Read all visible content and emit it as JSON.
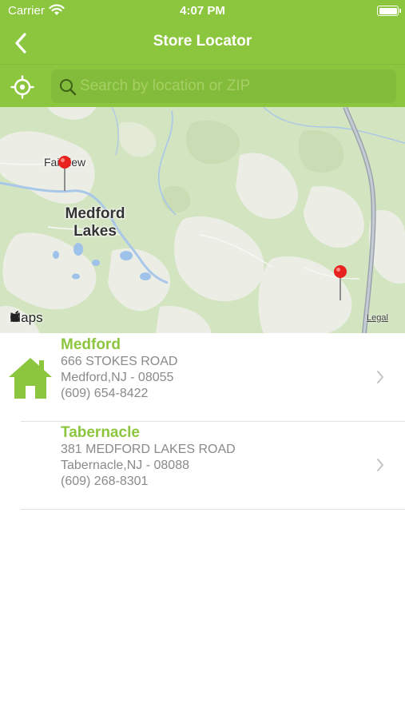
{
  "status_bar": {
    "carrier": "Carrier",
    "time": "4:07 PM",
    "wifi_icon": "wifi-icon",
    "battery_icon": "battery-icon"
  },
  "nav": {
    "title": "Store Locator",
    "back_icon": "chevron-left-icon"
  },
  "search": {
    "placeholder": "Search by location or ZIP",
    "value": "",
    "locate_icon": "crosshair-icon",
    "search_icon": "magnifier-icon"
  },
  "map": {
    "labels": {
      "fairview": "Fairview",
      "medford_lakes": "Medford Lakes"
    },
    "attribution": "Maps",
    "legal": "Legal",
    "pins": 2
  },
  "stores": [
    {
      "name": "Medford",
      "address": "666 STOKES ROAD",
      "city_line": "Medford,NJ - 08055",
      "phone": "(609) 654-8422",
      "icon": "home-icon"
    },
    {
      "name": "Tabernacle",
      "address": "381 MEDFORD LAKES ROAD",
      "city_line": "Tabernacle,NJ - 08088",
      "phone": "(609) 268-8301"
    }
  ],
  "colors": {
    "brand_green": "#8cc63f",
    "search_box": "#83bb3a",
    "secondary_text": "#8a8a8a"
  }
}
